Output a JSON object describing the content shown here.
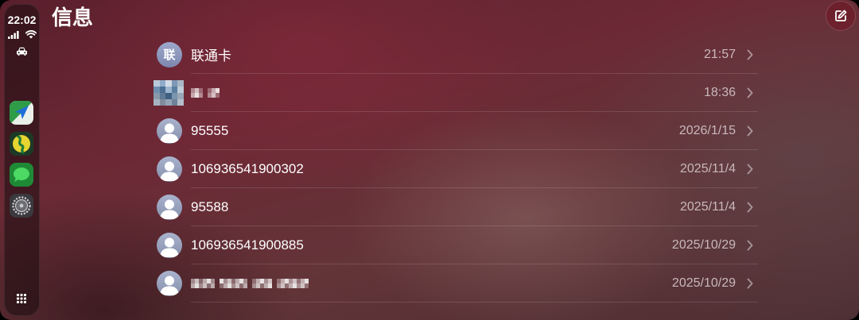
{
  "status": {
    "time": "22:02",
    "icons": [
      "signal-icon",
      "wifi-icon",
      "car-icon"
    ]
  },
  "sidebar": {
    "apps": [
      {
        "icon": "navigation-app-icon"
      },
      {
        "icon": "map-app-icon"
      },
      {
        "icon": "messages-app-icon"
      },
      {
        "icon": "settings-app-icon"
      }
    ],
    "home_icon": "app-grid-icon"
  },
  "header": {
    "title": "信息",
    "compose_icon": "compose-icon"
  },
  "conversations": [
    {
      "name": "联通卡",
      "time": "21:57",
      "avatar": {
        "type": "initial",
        "text": "联"
      }
    },
    {
      "redacted": true,
      "time": "18:36",
      "avatar": {
        "type": "redacted"
      }
    },
    {
      "name": "95555",
      "time": "2026/1/15",
      "avatar": {
        "type": "default"
      }
    },
    {
      "name": "106936541900302",
      "time": "2025/11/4",
      "avatar": {
        "type": "default"
      }
    },
    {
      "name": "95588",
      "time": "2025/11/4",
      "avatar": {
        "type": "default"
      }
    },
    {
      "name": "106936541900885",
      "time": "2025/10/29",
      "avatar": {
        "type": "default"
      }
    },
    {
      "redacted": true,
      "time": "2025/10/29",
      "avatar": {
        "type": "default"
      }
    }
  ],
  "colors": {
    "background": "#5e2430",
    "text_primary": "#ffffff",
    "text_secondary": "#c9b8ba",
    "avatar": "#9ba4c2"
  }
}
